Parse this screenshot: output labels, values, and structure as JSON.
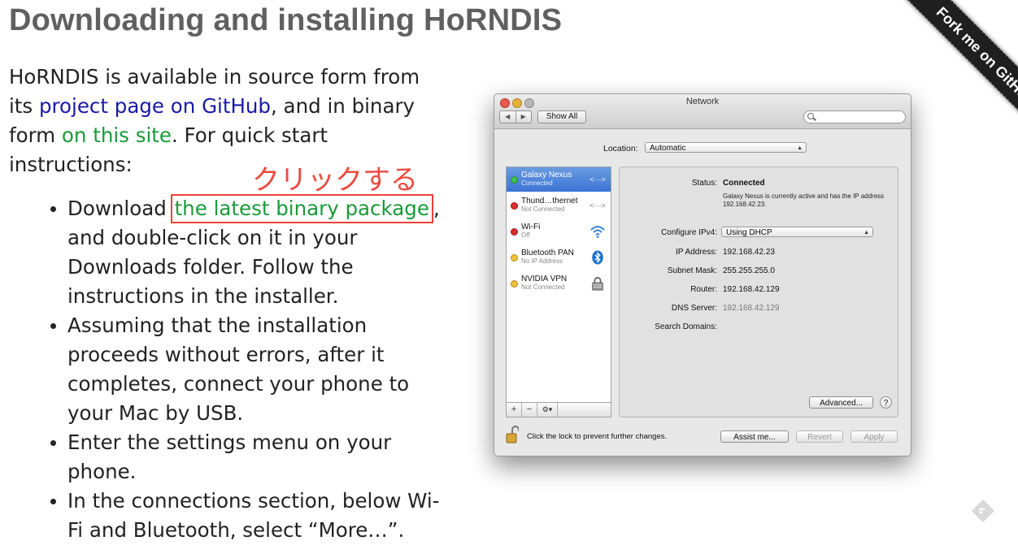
{
  "article": {
    "heading": "Downloading and installing HoRNDIS",
    "intro": {
      "part1": "HoRNDIS is available in source form from its ",
      "link_github": "project page on GitHub",
      "part2": ", and in binary form ",
      "link_site": "on this site",
      "part3": ". For quick start instructions:"
    },
    "annotation": "クリックする",
    "steps": [
      {
        "pre": "Download ",
        "link": "the latest binary package",
        "post": ", and double-click on it in your Downloads folder. Follow the instructions in the installer."
      },
      {
        "text": "Assuming that the installation proceeds without errors, after it completes, connect your phone to your Mac by USB."
      },
      {
        "text": "Enter the settings menu on your phone."
      },
      {
        "text": "In the connections section, below Wi-Fi and Bluetooth, select “More…”."
      }
    ]
  },
  "ribbon": {
    "label": "Fork me on GitHub",
    "color": "#1f1f1f"
  },
  "window": {
    "title": "Network",
    "nav_back": "◀",
    "nav_forward": "▶",
    "show_all": "Show All",
    "location_label": "Location:",
    "location_value": "Automatic",
    "services": [
      {
        "name": "Galaxy Nexus",
        "status": "Connected",
        "dot": "green",
        "icon": "ethernet-arrows-icon",
        "glyph": "<···>"
      },
      {
        "name": "Thund…thernet",
        "status": "Not Connected",
        "dot": "red",
        "icon": "ethernet-arrows-icon",
        "glyph": "<···>"
      },
      {
        "name": "Wi-Fi",
        "status": "Off",
        "dot": "red",
        "icon": "wifi-icon",
        "glyph": ""
      },
      {
        "name": "Bluetooth PAN",
        "status": "No IP Address",
        "dot": "yellow",
        "icon": "bluetooth-icon",
        "glyph": "ᛒ"
      },
      {
        "name": "NVIDIA VPN",
        "status": "Not Connected",
        "dot": "yellow",
        "icon": "vpn-lock-icon",
        "glyph": ""
      }
    ],
    "tools": {
      "add": "+",
      "remove": "−",
      "gear": "⚙▾"
    },
    "detail": {
      "status_label": "Status:",
      "status_value": "Connected",
      "status_desc": "Galaxy Nexus is currently active and has the IP address 192.168.42.23.",
      "ipv4_label": "Configure IPv4:",
      "ipv4_value": "Using DHCP",
      "ip_label": "IP Address:",
      "ip_value": "192.168.42.23",
      "mask_label": "Subnet Mask:",
      "mask_value": "255.255.255.0",
      "router_label": "Router:",
      "router_value": "192.168.42.129",
      "dns_label": "DNS Server:",
      "dns_value": "192.168.42.129",
      "search_label": "Search Domains:",
      "advanced": "Advanced...",
      "help": "?"
    },
    "lock_text": "Click the lock to prevent further changes.",
    "assist": "Assist me...",
    "revert": "Revert",
    "apply": "Apply"
  },
  "colors": {
    "link_blue": "#1a1aa6",
    "link_green": "#1b9a3a",
    "annotation_red": "#e8423a"
  }
}
